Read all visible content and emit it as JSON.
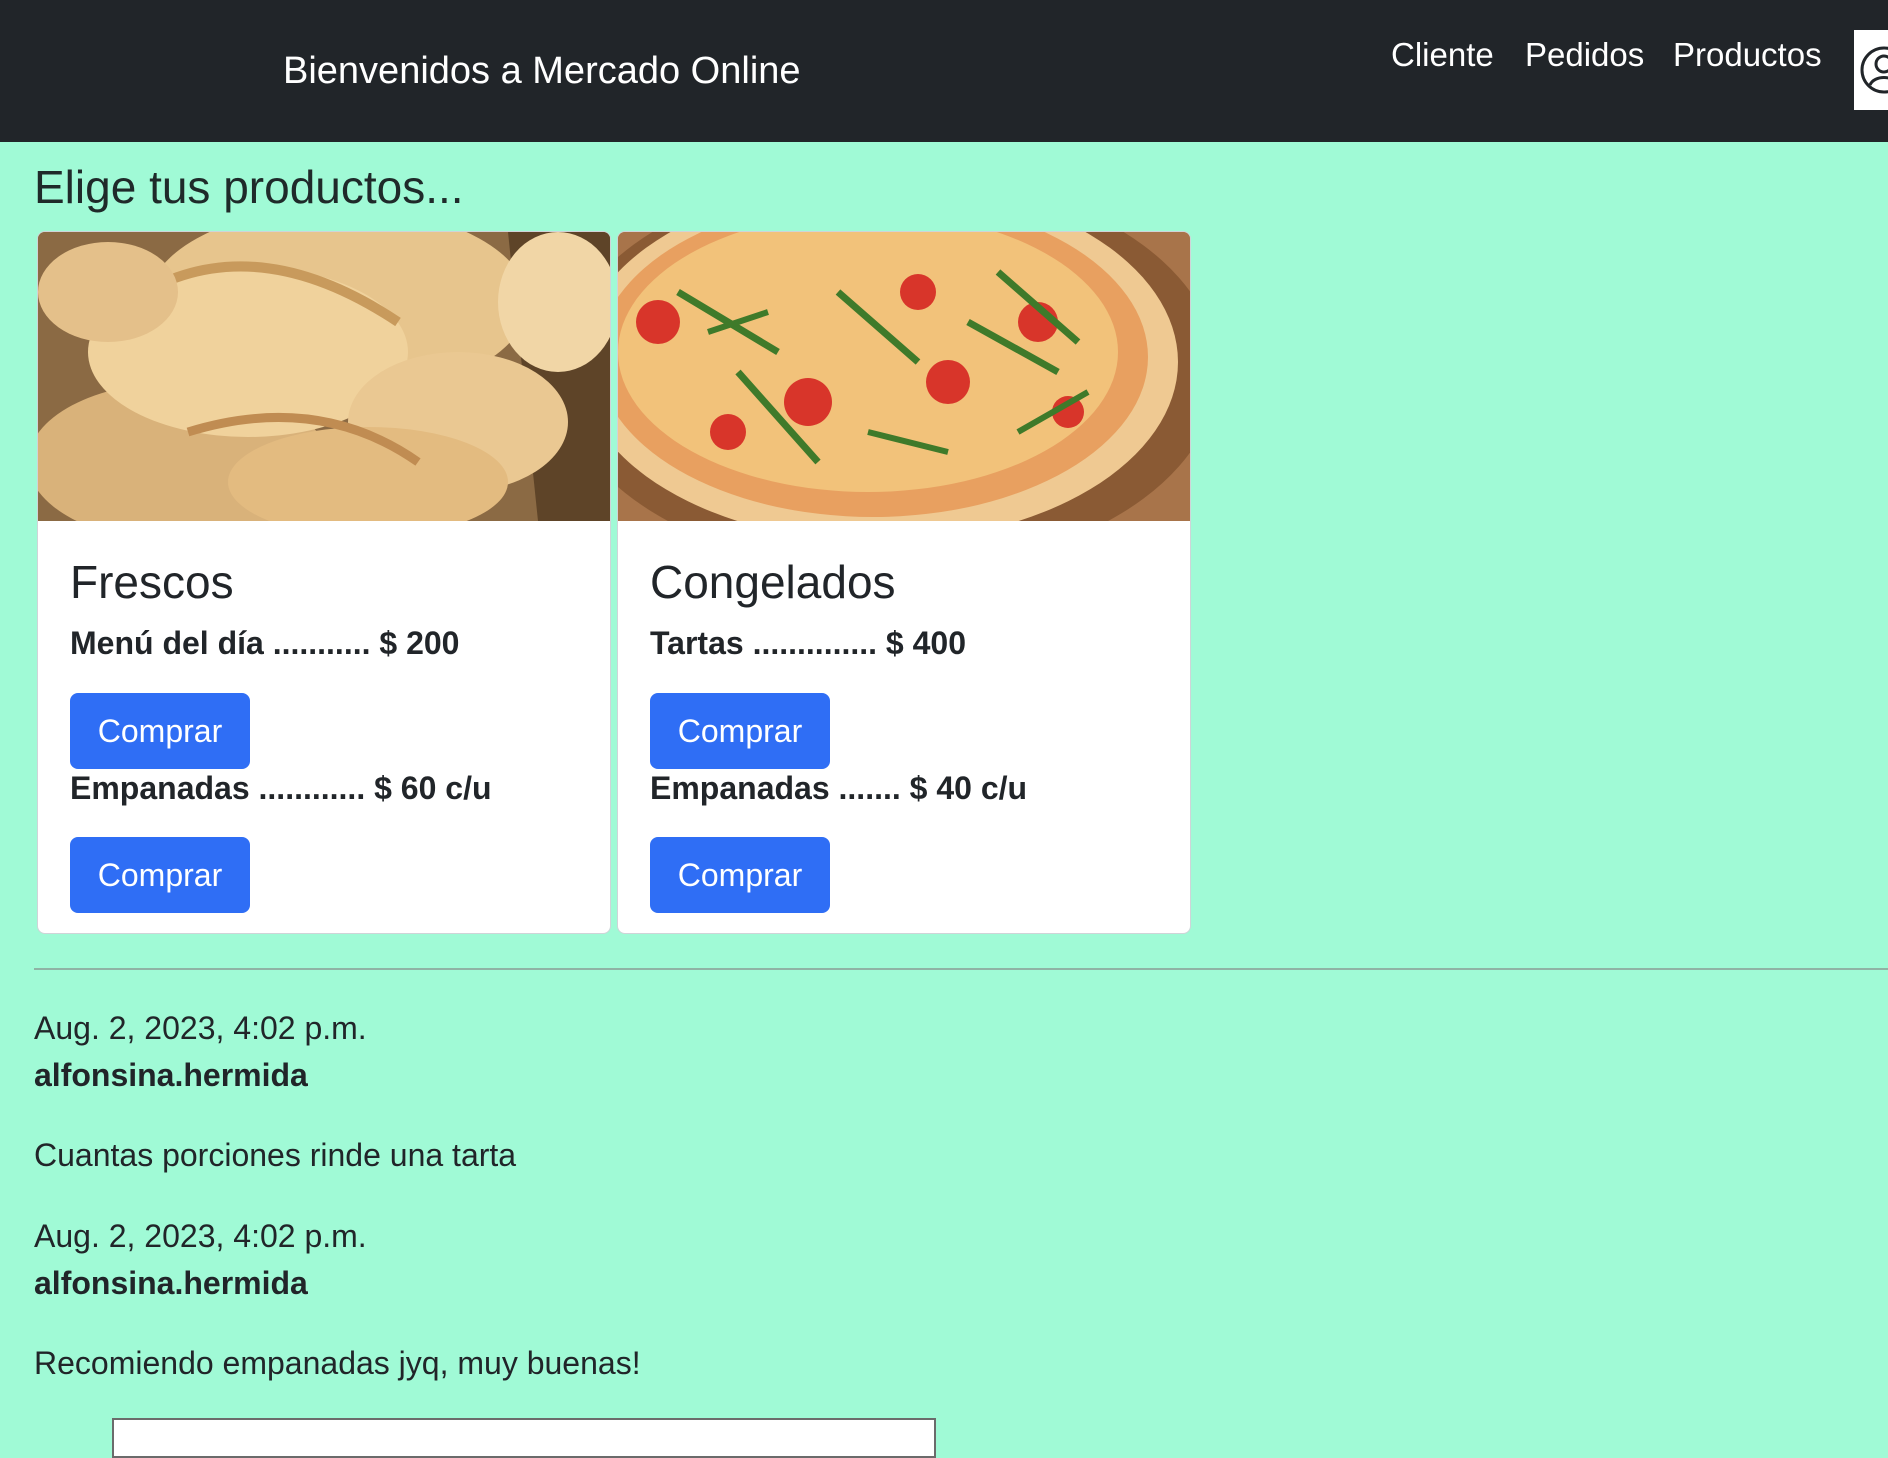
{
  "navbar": {
    "brand": "Bienvenidos a Mercado Online",
    "links": [
      "Cliente",
      "Pedidos",
      "Productos"
    ],
    "avatar_icon": "user-circle-icon"
  },
  "main": {
    "heading": "Elige tus productos...",
    "cards": [
      {
        "title": "Frescos",
        "image": "empanadas-photo",
        "items": [
          {
            "text": "Menú del día ........... $ 200",
            "button": "Comprar"
          },
          {
            "text": "Empanadas ............ $ 60 c/u",
            "button": "Comprar"
          }
        ]
      },
      {
        "title": "Congelados",
        "image": "pizza-photo",
        "items": [
          {
            "text": "Tartas .............. $ 400",
            "button": "Comprar"
          },
          {
            "text": "Empanadas ....... $ 40 c/u",
            "button": "Comprar"
          }
        ]
      }
    ]
  },
  "comments": [
    {
      "date": "Aug. 2, 2023, 4:02 p.m.",
      "user": "alfonsina.hermida",
      "text": "Cuantas porciones rinde una tarta"
    },
    {
      "date": "Aug. 2, 2023, 4:02 p.m.",
      "user": "alfonsina.hermida",
      "text": "Recomiendo empanadas jyq, muy buenas!"
    }
  ],
  "colors": {
    "navbar_bg": "#212529",
    "page_bg": "#a0fad6",
    "button_bg": "#2f6ef5"
  }
}
